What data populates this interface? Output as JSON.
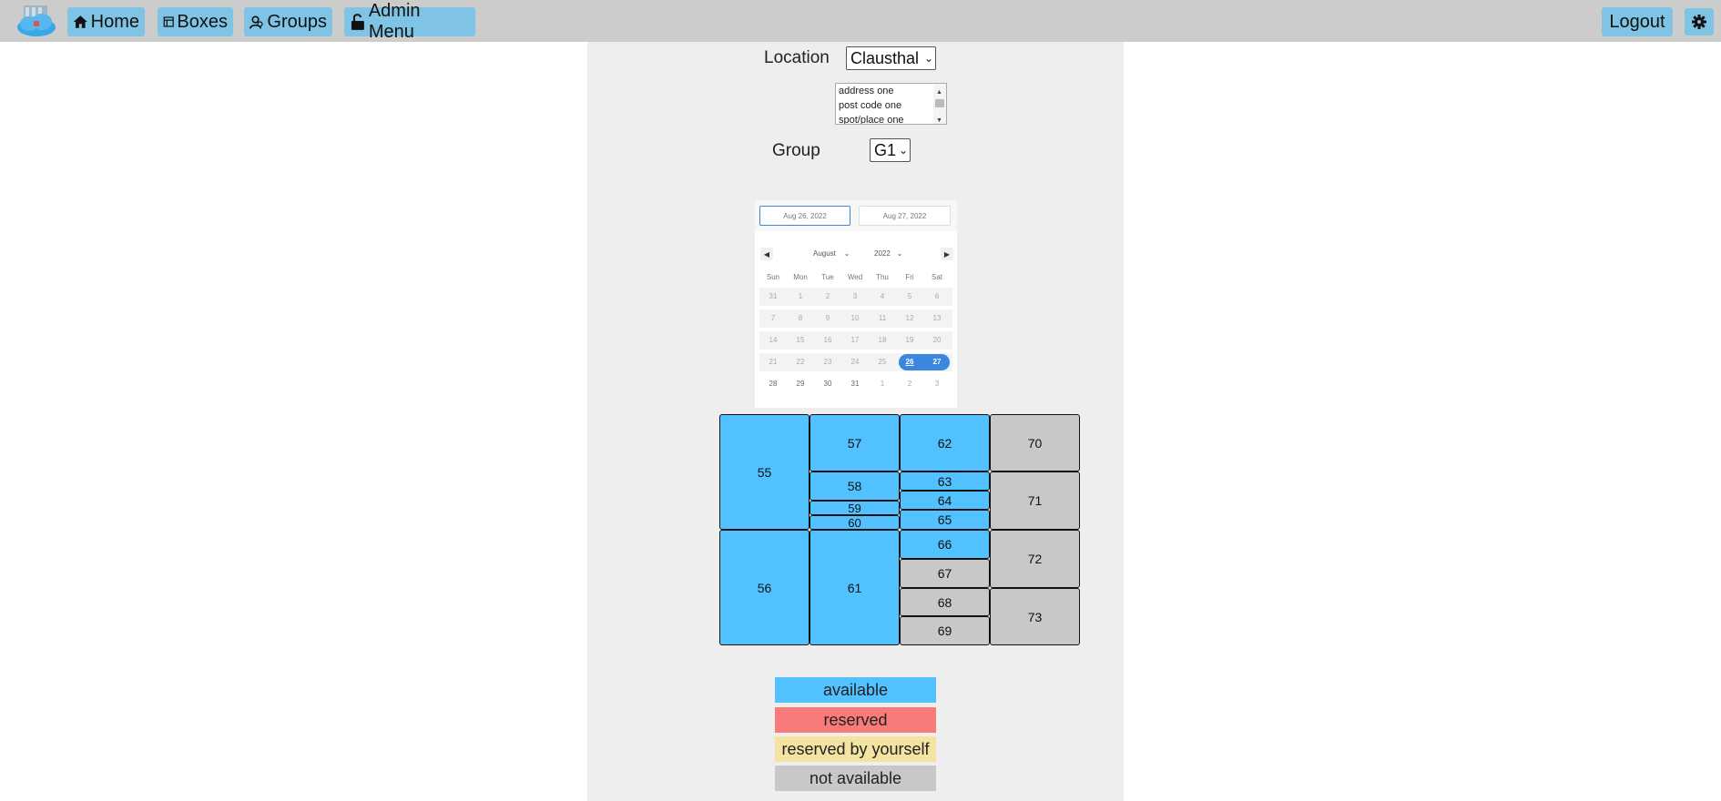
{
  "nav": {
    "home_label": "Home",
    "boxes_label": "Boxes",
    "groups_label": "Groups",
    "admin_label": "Admin Menu",
    "logout_label": "Logout",
    "icons": [
      "logo-cloud-icon",
      "home-icon",
      "boxes-icon",
      "groups-icon",
      "unlock-icon",
      "gear-icon"
    ]
  },
  "form": {
    "location_label": "Location",
    "location_value": "Clausthal",
    "address_lines": [
      "address one",
      "post code one",
      "spot/place one"
    ],
    "group_label": "Group",
    "group_value": "G1"
  },
  "calendar": {
    "start_date": "Aug 26, 2022",
    "end_date": "Aug 27, 2022",
    "month": "August",
    "year": "2022",
    "weekdays": [
      "Sun",
      "Mon",
      "Tue",
      "Wed",
      "Thu",
      "Fri",
      "Sat"
    ],
    "weeks": [
      [
        "31",
        "1",
        "2",
        "3",
        "4",
        "5",
        "6"
      ],
      [
        "7",
        "8",
        "9",
        "10",
        "11",
        "12",
        "13"
      ],
      [
        "14",
        "15",
        "16",
        "17",
        "18",
        "19",
        "20"
      ],
      [
        "21",
        "22",
        "23",
        "24",
        "25",
        "26",
        "27"
      ],
      [
        "28",
        "29",
        "30",
        "31",
        "1",
        "2",
        "3"
      ]
    ],
    "selected_range": [
      "26",
      "27"
    ]
  },
  "boxes": [
    {
      "id": "55",
      "status": "available"
    },
    {
      "id": "56",
      "status": "available"
    },
    {
      "id": "57",
      "status": "available"
    },
    {
      "id": "58",
      "status": "available"
    },
    {
      "id": "59",
      "status": "available"
    },
    {
      "id": "60",
      "status": "available"
    },
    {
      "id": "61",
      "status": "available"
    },
    {
      "id": "62",
      "status": "available"
    },
    {
      "id": "63",
      "status": "available"
    },
    {
      "id": "64",
      "status": "available"
    },
    {
      "id": "65",
      "status": "available"
    },
    {
      "id": "66",
      "status": "available"
    },
    {
      "id": "67",
      "status": "not available"
    },
    {
      "id": "68",
      "status": "not available"
    },
    {
      "id": "69",
      "status": "not available"
    },
    {
      "id": "70",
      "status": "not available"
    },
    {
      "id": "71",
      "status": "not available"
    },
    {
      "id": "72",
      "status": "not available"
    },
    {
      "id": "73",
      "status": "not available"
    }
  ],
  "legend": {
    "available": "available",
    "reserved": "reserved",
    "reserved_self": "reserved by yourself",
    "not_available": "not available",
    "colors": {
      "available": "#52c1ff",
      "reserved": "#f77b78",
      "reserved_self": "#f4e3a1",
      "not_available": "#c8c8c8"
    }
  }
}
